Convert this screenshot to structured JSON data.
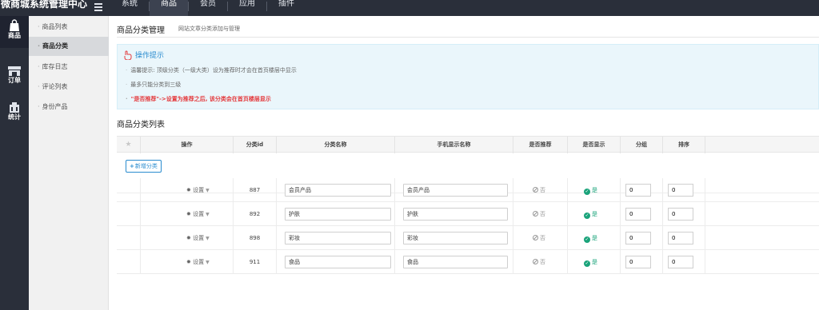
{
  "app": {
    "title": "微商城系统管理中心"
  },
  "topnav": [
    "系统",
    "商品",
    "会员",
    "应用",
    "插件"
  ],
  "rail": [
    {
      "label": "商品",
      "icon": "shopping-bag-icon"
    },
    {
      "label": "订单",
      "icon": "cart-icon"
    },
    {
      "label": "统计",
      "icon": "stats-icon"
    }
  ],
  "subnav": [
    "商品列表",
    "商品分类",
    "库存日志",
    "评论列表",
    "身份产品"
  ],
  "page": {
    "title": "商品分类管理",
    "subtitle": "网站文章分类添加与管理"
  },
  "tips": {
    "title": "操作提示",
    "lines": [
      "温馨提示: 顶级分类（一级大类）设为推荐时才会在首页楼层中显示",
      "最多只能分类到三级"
    ],
    "warning": "\"是否推荐\"->设置为推荐之后, 该分类会在首页楼层显示"
  },
  "list_title": "商品分类列表",
  "table": {
    "headers": {
      "star": "★",
      "op": "操作",
      "id": "分类id",
      "name": "分类名称",
      "mobile_name": "手机显示名称",
      "recommend": "是否推荐",
      "show": "是否显示",
      "group": "分组",
      "sort": "排序"
    },
    "add_button": "新增分类",
    "op_label": "设置",
    "rows": [
      {
        "id": "887",
        "name": "会员产品",
        "mobile_name": "会员产品",
        "recommend": "否",
        "show": "是",
        "group": "0",
        "sort": "0"
      },
      {
        "id": "892",
        "name": "护肤",
        "mobile_name": "护肤",
        "recommend": "否",
        "show": "是",
        "group": "0",
        "sort": "0"
      },
      {
        "id": "898",
        "name": "彩妆",
        "mobile_name": "彩妆",
        "recommend": "否",
        "show": "是",
        "group": "0",
        "sort": "0"
      },
      {
        "id": "911",
        "name": "食品",
        "mobile_name": "食品",
        "recommend": "否",
        "show": "是",
        "group": "0",
        "sort": "0"
      }
    ]
  },
  "colors": {
    "topbar": "#2a2f3a",
    "accent": "#2a8ccf",
    "success": "#1aa37a",
    "warning": "#e4393c"
  }
}
